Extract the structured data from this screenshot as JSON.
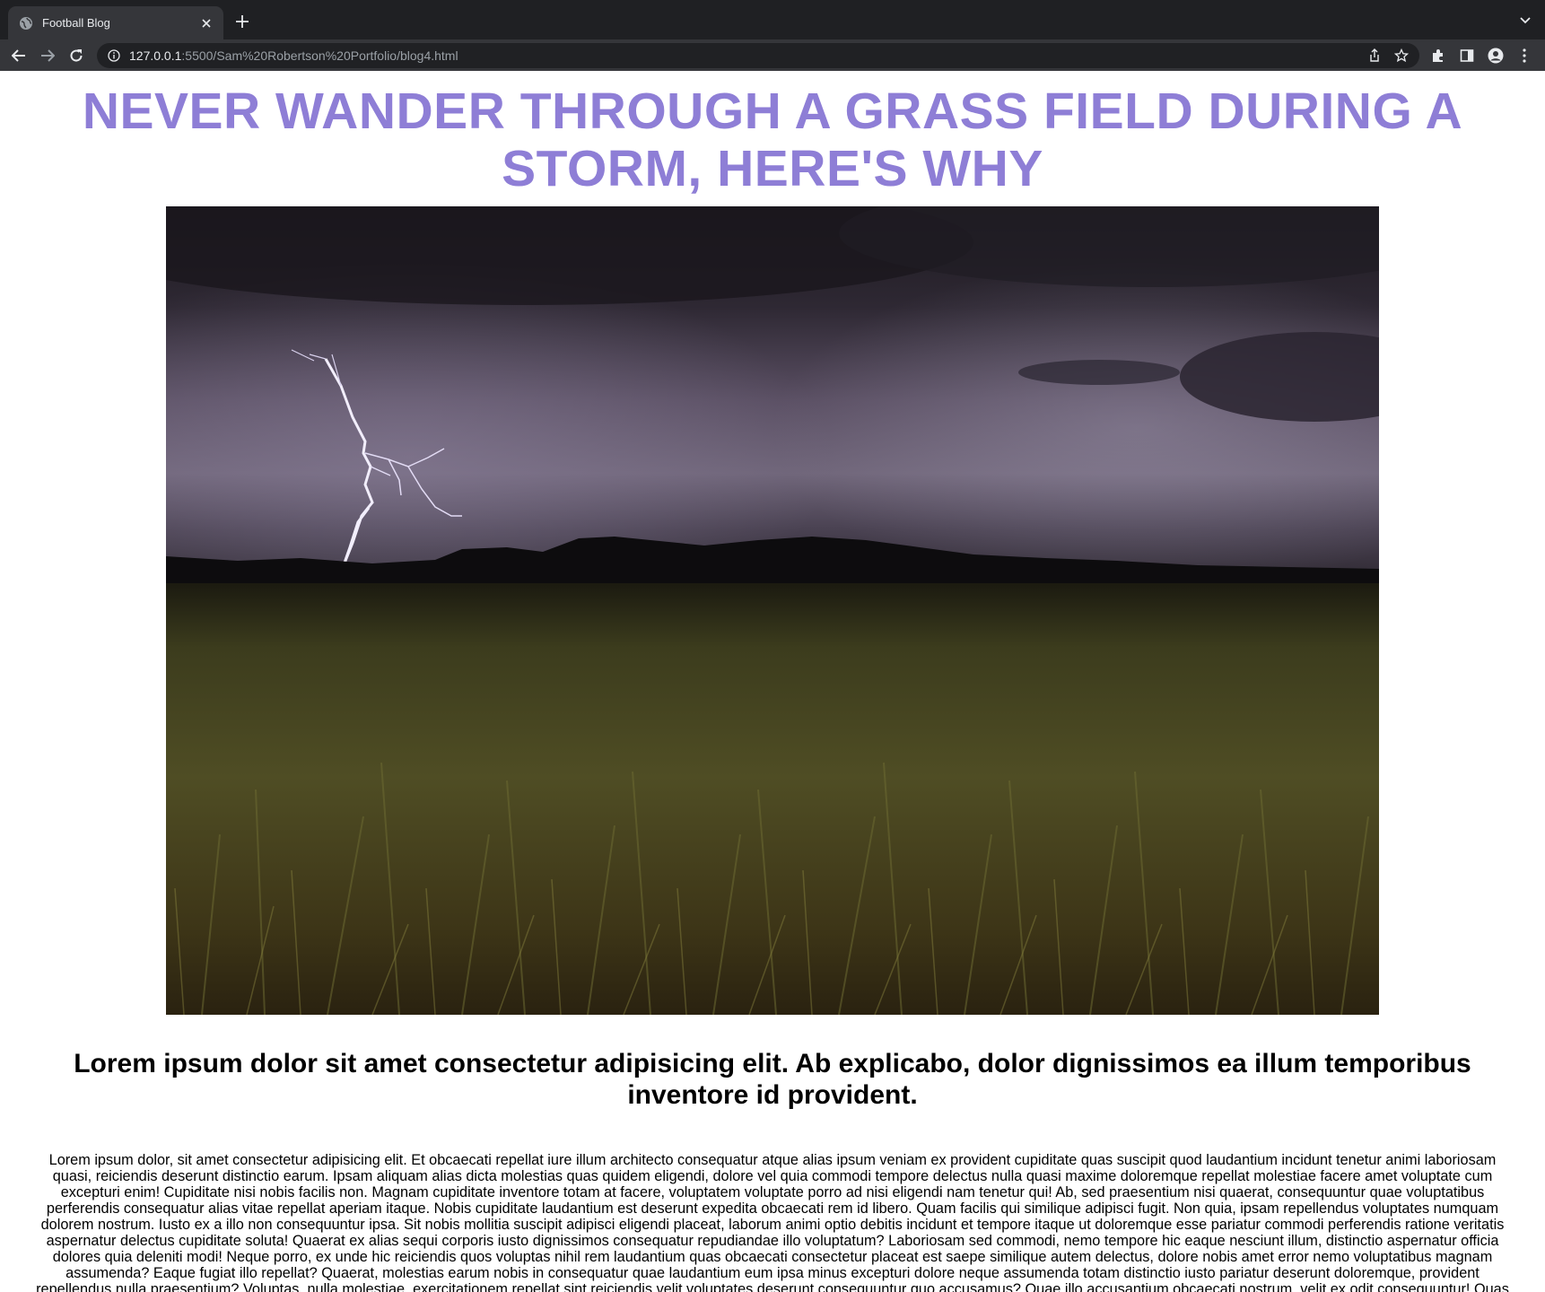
{
  "browser": {
    "tab_title": "Football Blog",
    "url_host": "127.0.0.1",
    "url_rest": ":5500/Sam%20Robertson%20Portfolio/blog4.html"
  },
  "article": {
    "title": "NEVER WANDER THROUGH A GRASS FIELD DURING A STORM, HERE'S WHY",
    "hero_image_alt": "lightning storm over grass field",
    "subtitle": "Lorem ipsum dolor sit amet consectetur adipisicing elit. Ab explicabo, dolor dignissimos ea illum temporibus inventore id provident.",
    "body": "Lorem ipsum dolor, sit amet consectetur adipisicing elit. Et obcaecati repellat iure illum architecto consequatur atque alias ipsum veniam ex provident cupiditate quas suscipit quod laudantium incidunt tenetur animi laboriosam quasi, reiciendis deserunt distinctio earum. Ipsam aliquam alias dicta molestias quas quidem eligendi, dolore vel quia commodi tempore delectus nulla quasi maxime doloremque repellat molestiae facere amet voluptate cum excepturi enim! Cupiditate nisi nobis facilis non. Magnam cupiditate inventore totam at facere, voluptatem voluptate porro ad nisi eligendi nam tenetur qui! Ab, sed praesentium nisi quaerat, consequuntur quae voluptatibus perferendis consequatur alias vitae repellat aperiam itaque. Nobis cupiditate laudantium est deserunt expedita obcaecati rem id libero. Quam facilis qui similique adipisci fugit. Non quia, ipsam repellendus voluptates numquam dolorem nostrum. Iusto ex a illo non consequuntur ipsa. Sit nobis mollitia suscipit adipisci eligendi placeat, laborum animi optio debitis incidunt et tempore itaque ut doloremque esse pariatur commodi perferendis ratione veritatis aspernatur delectus cupiditate soluta! Quaerat ex alias sequi corporis iusto dignissimos consequatur repudiandae illo voluptatum? Laboriosam sed commodi, nemo tempore hic eaque nesciunt illum, distinctio aspernatur officia dolores quia deleniti modi! Neque porro, ex unde hic reiciendis quos voluptas nihil rem laudantium quas obcaecati consectetur placeat est saepe similique autem delectus, dolore nobis amet error nemo voluptatibus magnam assumenda? Eaque fugiat illo repellat? Quaerat, molestias earum nobis in consequatur quae laudantium eum ipsa minus excepturi dolore neque assumenda totam distinctio iusto pariatur deserunt doloremque, provident repellendus nulla praesentium? Voluptas, nulla molestiae, exercitationem repellat sint reiciendis velit voluptates deserunt consequuntur quo accusamus? Quae illo accusantium obcaecati nostrum, velit ex odit consequuntur! Quas quam ea cupiditate, quos consequatur recusandae ad."
  },
  "colors": {
    "title": "#8e7ed6",
    "chrome_dark": "#1f2023",
    "chrome_toolbar": "#35363a"
  }
}
